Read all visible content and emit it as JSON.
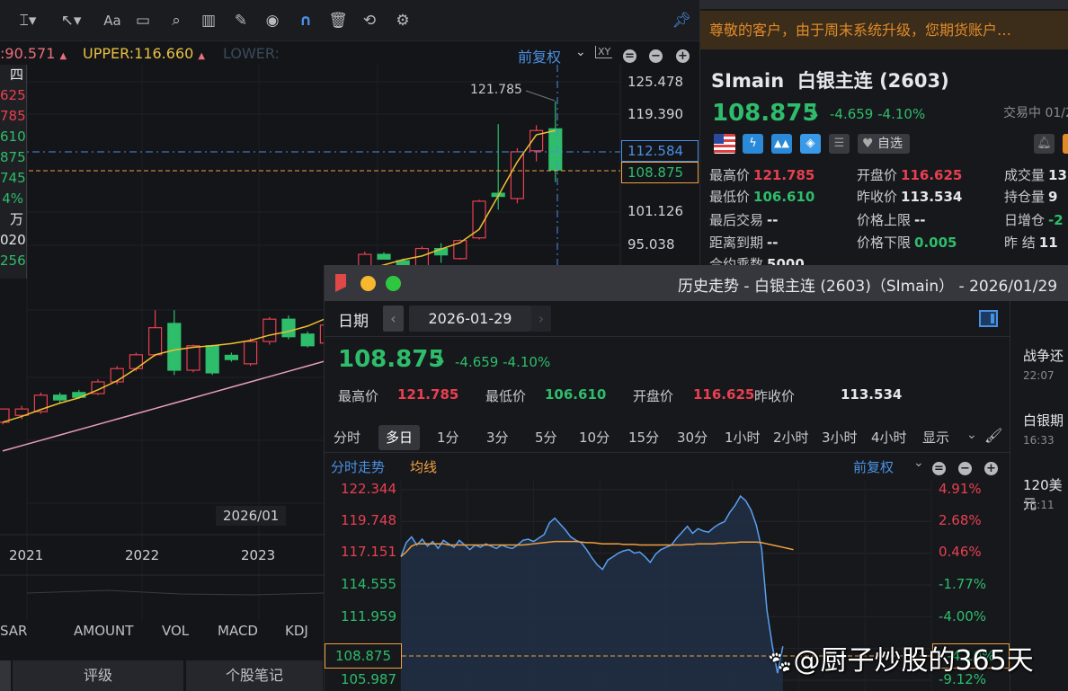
{
  "toolbar": {
    "icons": [
      "text-cursor-icon",
      "arrow-icon",
      "font-icon",
      "comment-icon",
      "search-icon",
      "candle-tool-icon",
      "pen-icon",
      "eye-icon",
      "magnet-icon",
      "trash-icon",
      "sync-icon",
      "gear-icon",
      "pin-icon"
    ],
    "font_label": "Aa"
  },
  "indicators": {
    "mid": ":90.571",
    "upper": "UPPER:116.660",
    "lower": "LOWER:",
    "adjust": "前复权"
  },
  "left_info": [
    {
      "v": "四",
      "c": "white"
    },
    {
      "v": "625",
      "c": "red"
    },
    {
      "v": "785",
      "c": "red"
    },
    {
      "v": "610",
      "c": "green"
    },
    {
      "v": "875",
      "c": "green"
    },
    {
      "v": "745",
      "c": "green"
    },
    {
      "v": "4%",
      "c": "green"
    },
    {
      "v": "万张",
      "c": "white"
    },
    {
      "v": "020",
      "c": "white"
    },
    {
      "v": "256",
      "c": "green"
    }
  ],
  "main_axis": {
    "ticks": [
      "125.478",
      "119.390",
      "101.126",
      "95.038"
    ],
    "crosshair_price": "112.584",
    "last_price": "108.875",
    "high_label": "121.785",
    "crosshair_date": "2026/01",
    "years": [
      "2021",
      "2022",
      "2023"
    ]
  },
  "indicator_tabs": [
    "SAR",
    "AMOUNT",
    "VOL",
    "MACD",
    "KDJ"
  ],
  "bottom_tabs": [
    "评级",
    "个股笔记"
  ],
  "chart_data": [
    {
      "type": "candlestick",
      "title": "SImain 白银主连 月K",
      "ylim": [
        60,
        125.478
      ],
      "candles": [
        [
          61.4,
          62,
          61,
          63.9
        ],
        [
          62.7,
          64.5,
          62,
          63.9
        ],
        [
          63.4,
          67,
          63,
          66.5
        ],
        [
          66.5,
          67,
          65,
          65.6
        ],
        [
          67,
          67.5,
          65.8,
          66.1
        ],
        [
          66.8,
          69.5,
          66.5,
          69
        ],
        [
          69,
          72,
          68.5,
          71.5
        ],
        [
          71.5,
          74.5,
          71,
          74.1
        ],
        [
          74.1,
          82.5,
          73.8,
          79.2
        ],
        [
          80,
          82.5,
          70.3,
          71.2
        ],
        [
          71.2,
          76,
          70.8,
          75.8
        ],
        [
          75.8,
          76,
          70.3,
          70.7
        ],
        [
          74,
          74.5,
          72.8,
          73.2
        ],
        [
          72.4,
          77.2,
          72,
          76.6
        ],
        [
          76.6,
          81.2,
          76,
          80.8
        ],
        [
          80.8,
          81.5,
          77,
          77.5
        ],
        [
          78,
          78.5,
          75.5,
          75.8
        ],
        [
          76.3,
          80,
          76,
          79.7
        ],
        [
          79.7,
          86,
          79,
          85
        ],
        [
          90.7,
          93.5,
          90.3,
          93.0
        ],
        [
          93.0,
          93.4,
          92,
          92.1
        ],
        [
          91.8,
          92.2,
          90.6,
          91.0
        ],
        [
          90.7,
          94.5,
          90.3,
          94.1
        ],
        [
          94.1,
          95.1,
          91.4,
          92.9
        ],
        [
          92.2,
          95.8,
          92,
          95.6
        ],
        [
          96.1,
          103.3,
          95.8,
          103.0
        ],
        [
          104.5,
          117.5,
          101.4,
          103.9
        ],
        [
          103.5,
          113,
          102.6,
          112.3
        ],
        [
          112.5,
          117.3,
          110.5,
          116.3
        ],
        [
          116.625,
          121.785,
          106.61,
          108.875
        ]
      ],
      "ma_yellow": [
        61.4,
        62.5,
        63.8,
        65,
        66,
        67.5,
        69.2,
        71.5,
        74.1,
        75,
        75.5,
        75.8,
        76.2,
        76.8,
        77.8,
        78.5,
        79.5,
        81,
        84,
        90.1,
        91,
        92,
        92.7,
        94,
        95.2,
        97.7,
        104,
        110.4,
        115.5,
        116.3
      ],
      "ma_pink": [
        56,
        57,
        58,
        59,
        60,
        61,
        62,
        63,
        64,
        65,
        66,
        67,
        68,
        69,
        70,
        71,
        72,
        73,
        74,
        75.5,
        77,
        78,
        79,
        80,
        81,
        82,
        83,
        84,
        85,
        86
      ]
    },
    {
      "type": "line",
      "title": "分时走势",
      "legend": [
        "分时走势",
        "均线"
      ],
      "slots": 100,
      "ylim": [
        105.987,
        122.344
      ],
      "left_ticks": [
        {
          "v": "122.344",
          "c": "red"
        },
        {
          "v": "119.748",
          "c": "red"
        },
        {
          "v": "117.151",
          "c": "red"
        },
        {
          "v": "114.555",
          "c": "green"
        },
        {
          "v": "111.959",
          "c": "green"
        },
        {
          "v": "105.987",
          "c": "green"
        }
      ],
      "right_ticks": [
        {
          "v": "4.91%",
          "c": "red"
        },
        {
          "v": "2.68%",
          "c": "red"
        },
        {
          "v": "0.46%",
          "c": "red"
        },
        {
          "v": "-1.77%",
          "c": "green"
        },
        {
          "v": "-4.00%",
          "c": "green"
        },
        {
          "v": "-9.12%",
          "c": "green"
        }
      ],
      "current_price": "108.875",
      "price": [
        116.6,
        117.8,
        118.3,
        117.6,
        118.1,
        117.5,
        117.9,
        117.3,
        118.0,
        117.7,
        117.4,
        118.0,
        117.6,
        117.2,
        117.6,
        117.4,
        117.7,
        117.5,
        117.3,
        117.6,
        117.4,
        117.3,
        117.6,
        118.0,
        118.1,
        117.9,
        118.2,
        118.5,
        119.5,
        119.9,
        119.4,
        118.9,
        118.3,
        118.0,
        117.8,
        117.2,
        116.5,
        115.9,
        115.5,
        116.3,
        116.6,
        116.9,
        117.1,
        117.2,
        116.9,
        117.0,
        116.6,
        116.1,
        116.8,
        117.2,
        117.4,
        117.6,
        118.2,
        118.7,
        119.2,
        118.6,
        119.0,
        118.8,
        118.7,
        119.1,
        119.4,
        119.6,
        120.4,
        121.0,
        121.8,
        121.4,
        120.6,
        119.3,
        117.3,
        112.0,
        109.0,
        106.6,
        108.9
      ],
      "avg": [
        116.6,
        117.0,
        117.5,
        117.7,
        117.7,
        117.7,
        117.7,
        117.7,
        117.7,
        117.6,
        117.6,
        117.6,
        117.6,
        117.6,
        117.6,
        117.6,
        117.6,
        117.6,
        117.6,
        117.6,
        117.6,
        117.6,
        117.6,
        117.6,
        117.65,
        117.7,
        117.75,
        117.8,
        117.85,
        117.9,
        117.9,
        117.9,
        117.9,
        117.9,
        117.85,
        117.8,
        117.8,
        117.75,
        117.7,
        117.7,
        117.7,
        117.7,
        117.65,
        117.65,
        117.65,
        117.6,
        117.6,
        117.6,
        117.6,
        117.6,
        117.6,
        117.6,
        117.6,
        117.6,
        117.65,
        117.65,
        117.7,
        117.7,
        117.7,
        117.7,
        117.75,
        117.75,
        117.8,
        117.8,
        117.85,
        117.85,
        117.85,
        117.85,
        117.8,
        117.7,
        117.6,
        117.5,
        117.4,
        117.3,
        117.2
      ]
    }
  ],
  "right_panel": {
    "notice": "尊敬的客户，由于周末系统升级，您期货账户…",
    "symbol": "SImain",
    "name": "白银主连 (2603)",
    "price": "108.875",
    "change": "-4.659",
    "change_pct": "-4.10%",
    "status": "交易中 01/2",
    "watch_label": "自选",
    "stats": [
      {
        "k": "最高价",
        "v": "121.785",
        "c": "red"
      },
      {
        "k": "开盘价",
        "v": "116.625",
        "c": "red"
      },
      {
        "k": "成交量",
        "v": "13",
        "c": "white"
      },
      {
        "k": "最低价",
        "v": "106.610",
        "c": "green"
      },
      {
        "k": "昨收价",
        "v": "113.534",
        "c": "white"
      },
      {
        "k": "持仓量",
        "v": "9",
        "c": "white"
      },
      {
        "k": "最后交易",
        "v": "--",
        "c": "white"
      },
      {
        "k": "价格上限",
        "v": "--",
        "c": "white"
      },
      {
        "k": "日增仓",
        "v": "-2",
        "c": "green"
      },
      {
        "k": "距离到期",
        "v": "--",
        "c": "white"
      },
      {
        "k": "价格下限",
        "v": "0.005",
        "c": "green"
      },
      {
        "k": "昨  结",
        "v": "11",
        "c": "white"
      },
      {
        "k": "合约乘数",
        "v": "5000",
        "c": "white"
      }
    ]
  },
  "history_window": {
    "title": "历史走势 - 白银主连 (2603)（SImain） - 2026/01/29",
    "date_label": "日期",
    "date": "2026-01-29",
    "price": "108.875",
    "change": "-4.659",
    "change_pct": "-4.10%",
    "stats": [
      {
        "k": "最高价",
        "v": "121.785",
        "c": "red"
      },
      {
        "k": "最低价",
        "v": "106.610",
        "c": "green"
      },
      {
        "k": "开盘价",
        "v": "116.625",
        "c": "red"
      },
      {
        "k": "昨收价",
        "v": "113.534",
        "c": "white"
      }
    ],
    "periods": [
      "分时",
      "多日",
      "1分",
      "3分",
      "5分",
      "10分",
      "15分",
      "30分",
      "1小时",
      "2小时",
      "3小时",
      "4小时",
      "显示"
    ],
    "active_period": "多日",
    "chart_tab": "分时走势",
    "avg_tab": "均线",
    "adjust": "前复权",
    "current_pct": "-4.10%",
    "news": [
      {
        "t": "战争还",
        "d": "22:07"
      },
      {
        "t": "白银期",
        "d": "16:33"
      },
      {
        "t": "120美元",
        "d": "15:11"
      }
    ]
  },
  "watermark": "@厨子炒股的365天",
  "colors": {
    "up": "#e8404f",
    "down": "#2ebd6b",
    "accent": "#4a90e2",
    "avg": "#f0a040"
  }
}
